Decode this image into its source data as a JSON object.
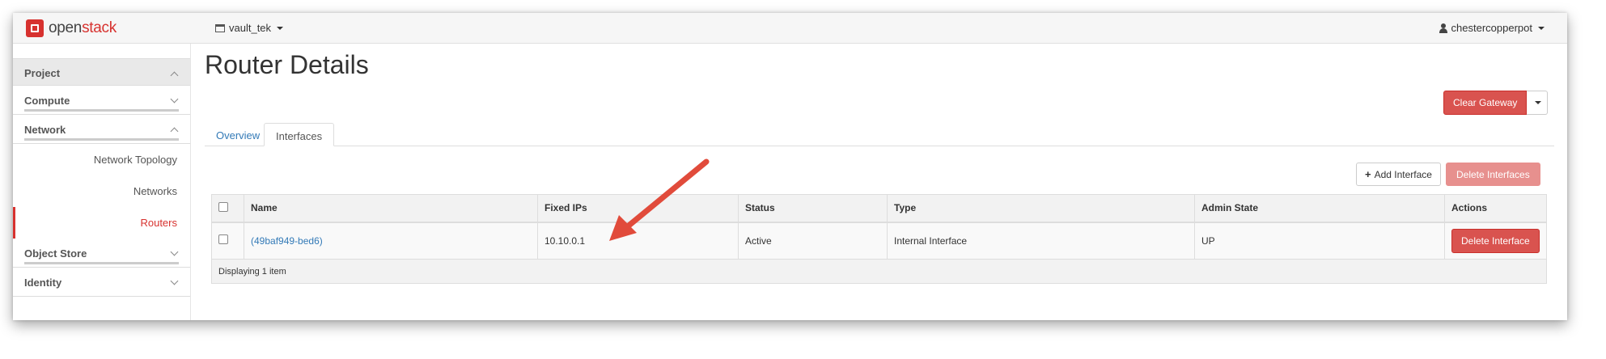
{
  "brand": {
    "prefix": "open",
    "suffix": "stack"
  },
  "header": {
    "project": "vault_tek",
    "user": "chestercopperpot"
  },
  "sidebar": {
    "panels": [
      {
        "label": "Project",
        "state": "open"
      },
      {
        "label": "Compute",
        "state": "closed"
      },
      {
        "label": "Network",
        "state": "open"
      }
    ],
    "network_items": [
      "Network Topology",
      "Networks",
      "Routers"
    ],
    "active_item": "Routers",
    "lower_panels": [
      {
        "label": "Object Store",
        "state": "closed"
      },
      {
        "label": "Identity",
        "state": "closed"
      }
    ]
  },
  "page": {
    "title": "Router Details"
  },
  "actions": {
    "clear_gateway": "Clear Gateway",
    "add_interface": "Add Interface",
    "delete_interfaces": "Delete Interfaces"
  },
  "tabs": [
    {
      "label": "Overview",
      "active": false
    },
    {
      "label": "Interfaces",
      "active": true
    }
  ],
  "table": {
    "columns": [
      "Name",
      "Fixed IPs",
      "Status",
      "Type",
      "Admin State",
      "Actions"
    ],
    "rows": [
      {
        "name": "(49baf949-bed6)",
        "fixed_ips": "10.10.0.1",
        "status": "Active",
        "type": "Internal Interface",
        "admin_state": "UP",
        "action": "Delete Interface"
      }
    ],
    "footer": "Displaying 1 item"
  },
  "colors": {
    "accent": "#d7322f",
    "danger": "#d9534f",
    "link": "#337ab7",
    "arrow": "#e14b3b"
  }
}
